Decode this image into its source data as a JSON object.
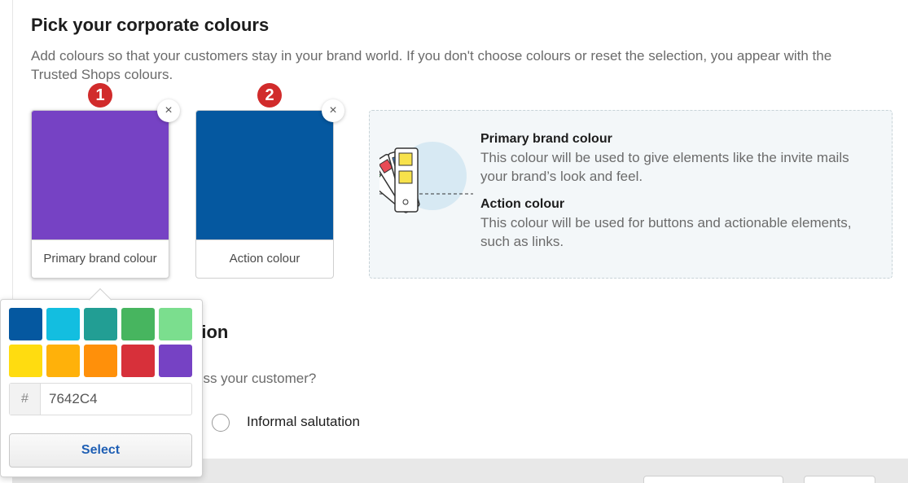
{
  "section": {
    "title": "Pick your corporate colours",
    "description": "Add colours so that your customers stay in your brand world. If you don't choose colours or reset the selection, you appear with the Trusted Shops colours."
  },
  "markers": [
    "1",
    "2"
  ],
  "swatches": [
    {
      "label": "Primary brand colour",
      "color": "#7642C4",
      "remove_icon": "×"
    },
    {
      "label": "Action colour",
      "color": "#0558A0",
      "remove_icon": "×"
    }
  ],
  "info": {
    "primary_title": "Primary brand colour",
    "primary_text": "This colour will be used to give elements like the invite mails your brand’s look and feel.",
    "action_title": "Action colour",
    "action_text": "This colour will be used for buttons and actionable elements, such as links."
  },
  "salutation": {
    "title_partial": "tion",
    "question_partial": "ess your customer?",
    "option_label": "Informal salutation"
  },
  "picker": {
    "palette": [
      "#0558A0",
      "#13BEE0",
      "#229E94",
      "#47B55F",
      "#7BDE8E",
      "#FFDC10",
      "#FFB10A",
      "#FF900A",
      "#D7303A",
      "#7642C4"
    ],
    "hex_prefix": "#",
    "hex_value": "7642C4",
    "select_label": "Select"
  }
}
